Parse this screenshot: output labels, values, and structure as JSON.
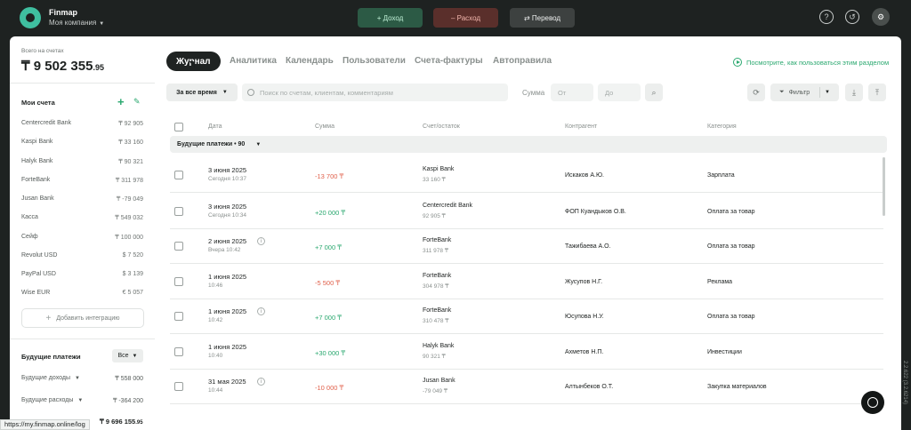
{
  "topbar": {
    "brand": "Finmap",
    "company": "Моя компания",
    "income_label": "+ Доход",
    "expense_label": "– Расход",
    "transfer_label": "⇄ Перевод"
  },
  "sidebar": {
    "total_label": "Всего на счетах",
    "total_value": "₸ 9 502 355",
    "total_cents": ".95",
    "accounts_title": "Мои счета",
    "accounts": [
      {
        "name": "Centercredit Bank",
        "amount": "₸ 92 905"
      },
      {
        "name": "Kaspi Bank",
        "amount": "₸ 33 160"
      },
      {
        "name": "Halyk Bank",
        "amount": "₸ 90 321"
      },
      {
        "name": "ForteBank",
        "amount": "₸ 311 978"
      },
      {
        "name": "Jusan Bank",
        "amount": "₸ -79 049"
      },
      {
        "name": "Касса",
        "amount": "₸ 549 032"
      },
      {
        "name": "Сейф",
        "amount": "₸ 100 000"
      },
      {
        "name": "Revolut USD",
        "amount": "$ 7 520"
      },
      {
        "name": "PayPal USD",
        "amount": "$ 3 139"
      },
      {
        "name": "Wise EUR",
        "amount": "€ 5 057"
      }
    ],
    "add_integration": "Добавить интеграцию",
    "future_title": "Будущие платежи",
    "future_filter": "Все",
    "future_rows": [
      {
        "name": "Будущие доходы",
        "amount": "₸ 558 000"
      },
      {
        "name": "Будущие расходы",
        "amount": "₸ -364 200"
      }
    ],
    "future_total": "₸ 9 696 155",
    "future_total_cents": ".95"
  },
  "tabs": [
    "Журнал",
    "Аналитика",
    "Календарь",
    "Пользователи",
    "Счета-фактуры",
    "Автоправила"
  ],
  "howto_link": "Посмотрите, как пользоваться этим разделом",
  "filters": {
    "period": "За все время",
    "search_placeholder": "Поиск по счетам, клиентам, комментариям",
    "sum_label": "Сумма",
    "from_placeholder": "От",
    "to_placeholder": "До",
    "filter_label": "Фильтр"
  },
  "table": {
    "headers": [
      "Дата",
      "Сумма",
      "Счет/остаток",
      "Контрагент",
      "Категория"
    ],
    "group_label": "Будущие платежи • 90",
    "rows": [
      {
        "date": "3 июня 2025",
        "time": "Сегодня 10:37",
        "amount": "-13 700 ₸",
        "account": "Kaspi Bank",
        "balance": "33 160 ₸",
        "counterparty": "Искаков А.Ю.",
        "category": "Зарплата"
      },
      {
        "date": "3 июня 2025",
        "time": "Сегодня 10:34",
        "amount": "+20 000 ₸",
        "account": "Centercredit Bank",
        "balance": "92 905 ₸",
        "counterparty": "ФОП Куандыков О.В.",
        "category": "Оплата за товар"
      },
      {
        "date": "2 июня 2025",
        "time": "Вчера 10:42",
        "amount": "+7 000 ₸",
        "account": "ForteBank",
        "balance": "311 978 ₸",
        "counterparty": "Тажибаева А.О.",
        "category": "Оплата за товар"
      },
      {
        "date": "1 июня 2025",
        "time": "10:46",
        "amount": "-5 500 ₸",
        "account": "ForteBank",
        "balance": "304 978 ₸",
        "counterparty": "Жусупов Н.Г.",
        "category": "Реклама"
      },
      {
        "date": "1 июня 2025",
        "time": "10:42",
        "amount": "+7 000 ₸",
        "account": "ForteBank",
        "balance": "310 478 ₸",
        "counterparty": "Юсупова Н.У.",
        "category": "Оплата за товар"
      },
      {
        "date": "1 июня 2025",
        "time": "10:40",
        "amount": "+30 000 ₸",
        "account": "Halyk Bank",
        "balance": "90 321 ₸",
        "counterparty": "Ахметов Н.П.",
        "category": "Инвестиции"
      },
      {
        "date": "31 мая 2025",
        "time": "10:44",
        "amount": "-10 000 ₸",
        "account": "Jusan Bank",
        "balance": "-79 049 ₸",
        "counterparty": "Алтынбеков О.Т.",
        "category": "Закупка материалов"
      }
    ]
  },
  "status_url": "https://my.finmap.online/log",
  "version": "2.2.622 (3.2.6214)",
  "colors": {
    "accent": "#2aa86f",
    "negative": "#e0604b",
    "dark": "#1e2221"
  }
}
